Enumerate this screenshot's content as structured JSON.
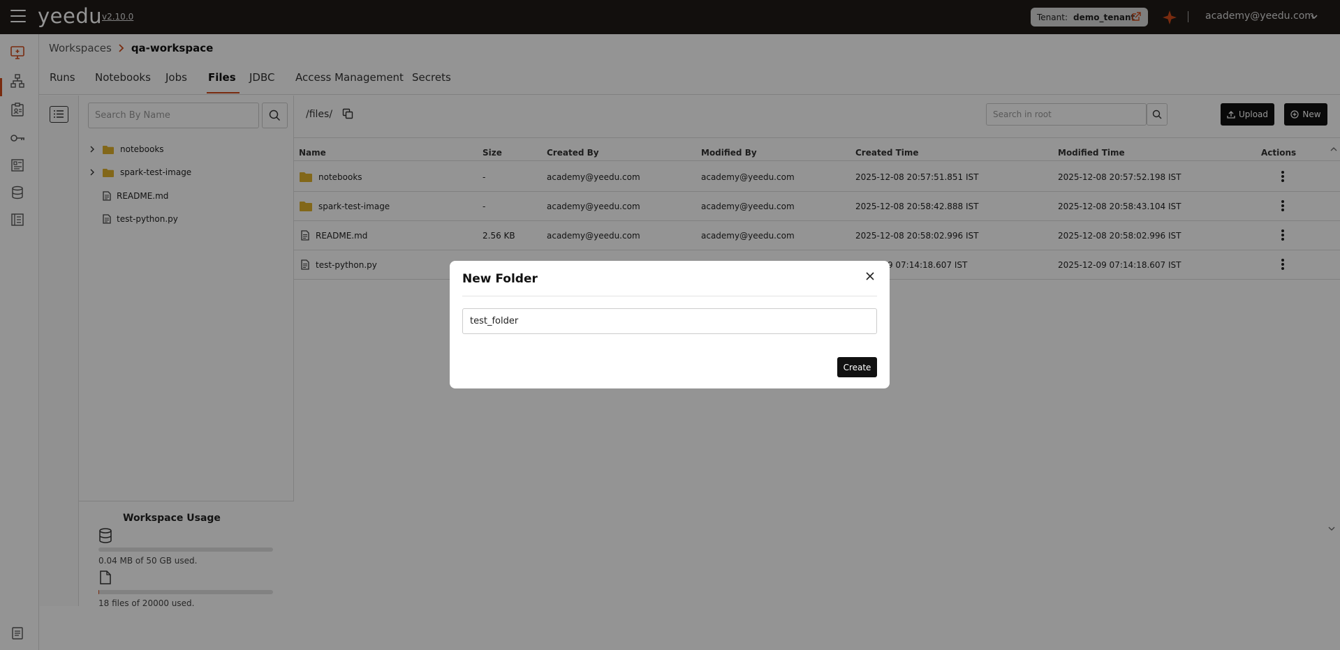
{
  "header": {
    "logo": "yeedu",
    "version": "v2.10.0",
    "tenant_label": "Tenant:",
    "tenant_value": "demo_tenant",
    "user_email": "academy@yeedu.com",
    "accent_color": "#d04a1b"
  },
  "breadcrumb": {
    "root": "Workspaces",
    "current": "qa-workspace"
  },
  "tabs": [
    {
      "label": "Runs",
      "active": false
    },
    {
      "label": "Notebooks",
      "active": false
    },
    {
      "label": "Jobs",
      "active": false
    },
    {
      "label": "Files",
      "active": true
    },
    {
      "label": "JDBC",
      "active": false
    },
    {
      "label": "Access Management",
      "active": false
    },
    {
      "label": "Secrets",
      "active": false
    }
  ],
  "tree": {
    "search_placeholder": "Search By Name",
    "items": [
      {
        "label": "notebooks",
        "type": "folder"
      },
      {
        "label": "spark-test-image",
        "type": "folder"
      },
      {
        "label": "README.md",
        "type": "file"
      },
      {
        "label": "test-python.py",
        "type": "file"
      }
    ]
  },
  "usage": {
    "title": "Workspace Usage",
    "storage_text": "0.04 MB of 50 GB used.",
    "storage_fraction": 0.0,
    "files_text": "18 files of 20000 used.",
    "files_fraction": 0.001
  },
  "files_panel": {
    "path": "/files/",
    "search_placeholder": "Search in root",
    "upload_label": "Upload",
    "new_label": "New",
    "columns": [
      "Name",
      "Size",
      "Created By",
      "Modified By",
      "Created Time",
      "Modified Time",
      "Actions"
    ],
    "rows": [
      {
        "name": "notebooks",
        "type": "folder",
        "size": "-",
        "created_by": "academy@yeedu.com",
        "modified_by": "academy@yeedu.com",
        "created_time": "2025-12-08 20:57:51.851 IST",
        "modified_time": "2025-12-08 20:57:52.198 IST"
      },
      {
        "name": "spark-test-image",
        "type": "folder",
        "size": "-",
        "created_by": "academy@yeedu.com",
        "modified_by": "academy@yeedu.com",
        "created_time": "2025-12-08 20:58:42.888 IST",
        "modified_time": "2025-12-08 20:58:43.104 IST"
      },
      {
        "name": "README.md",
        "type": "file",
        "size": "2.56 KB",
        "created_by": "academy@yeedu.com",
        "modified_by": "academy@yeedu.com",
        "created_time": "2025-12-08 20:58:02.996 IST",
        "modified_time": "2025-12-08 20:58:02.996 IST"
      },
      {
        "name": "test-python.py",
        "type": "file",
        "size": "",
        "created_by": "",
        "modified_by": "",
        "created_time": "-09 07:14:18.607 IST",
        "modified_time": "2025-12-09 07:14:18.607 IST"
      }
    ]
  },
  "modal": {
    "title": "New Folder",
    "input_value": "test_folder",
    "create_label": "Create"
  }
}
